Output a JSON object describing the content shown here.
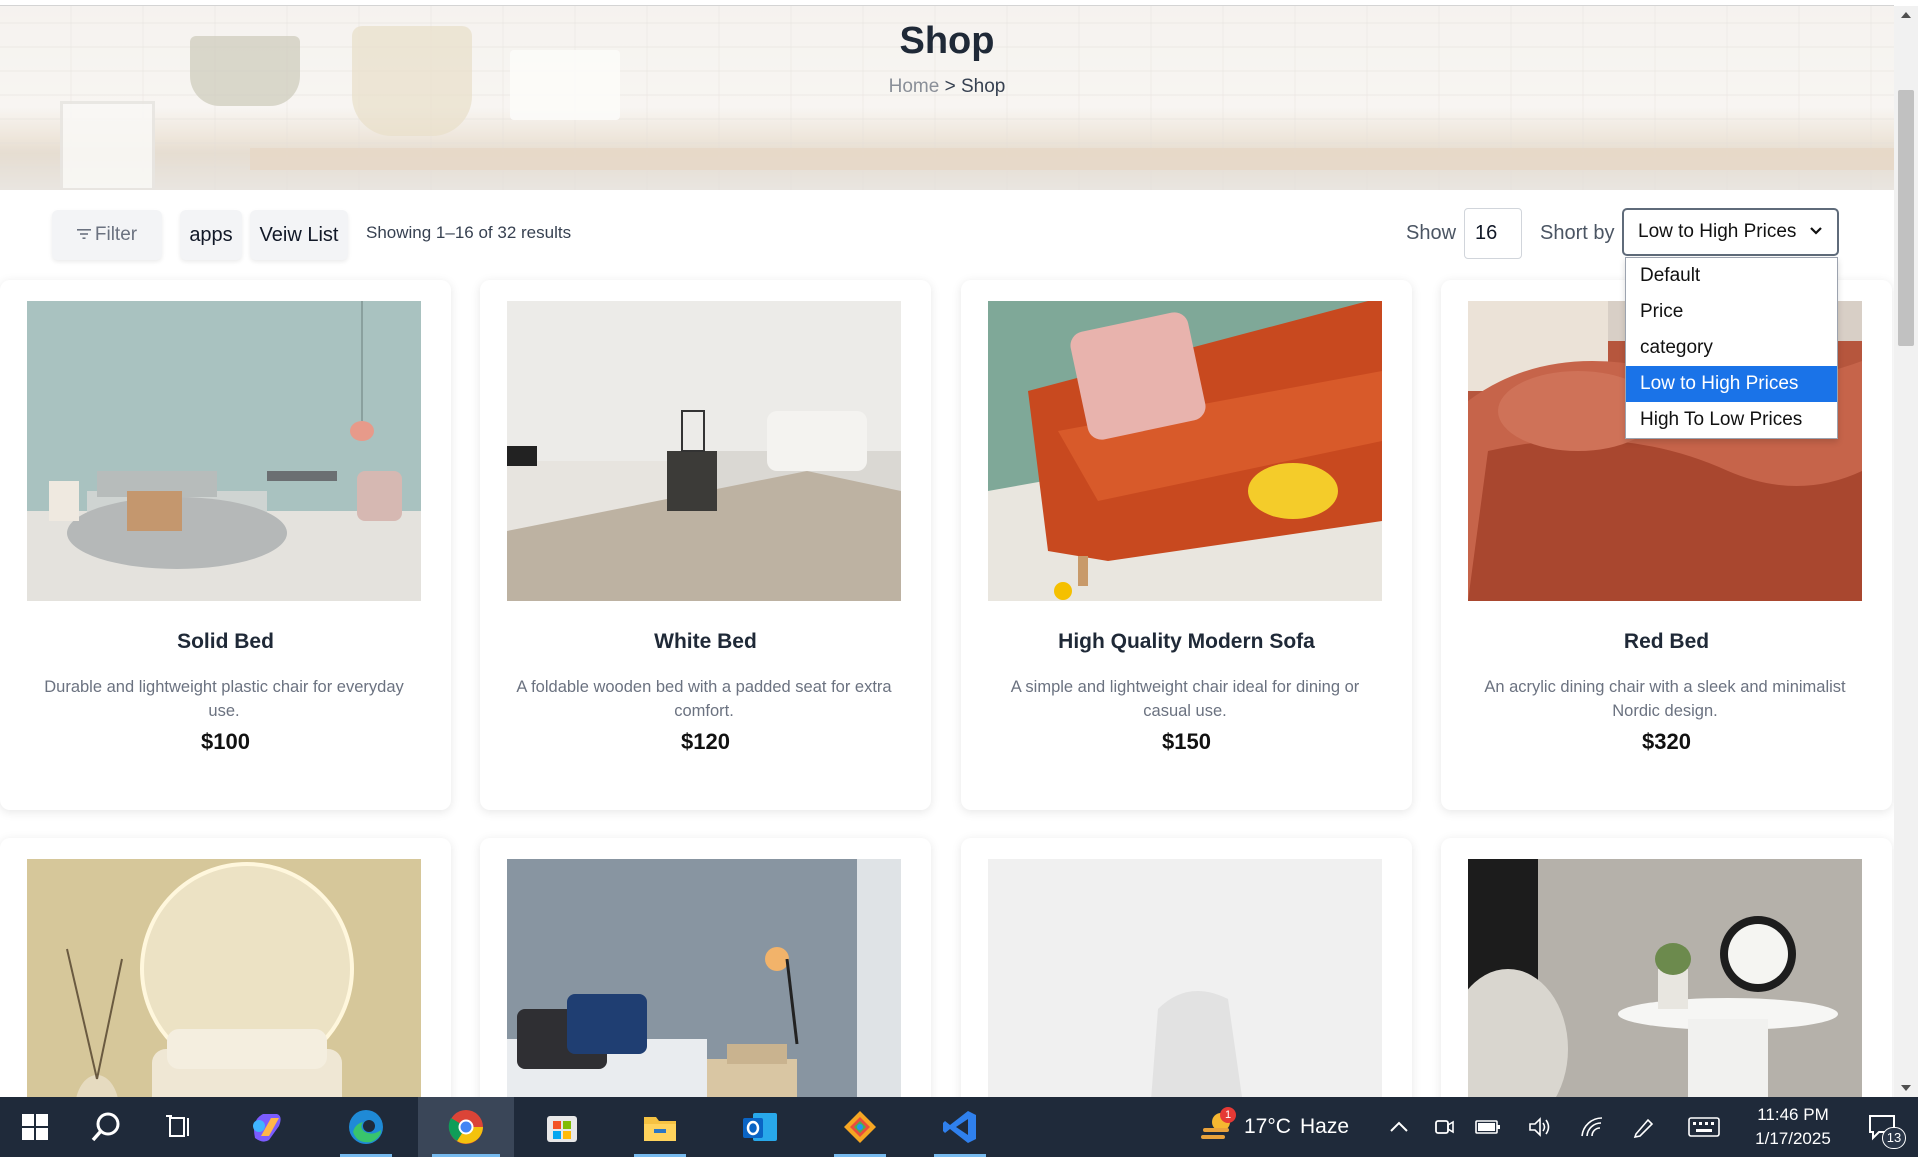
{
  "hero": {
    "title": "Shop",
    "breadcrumb_home": "Home",
    "breadcrumb_sep": ">",
    "breadcrumb_current": "Shop"
  },
  "toolbar": {
    "filter_label": "Filter",
    "apps_label": "apps",
    "list_label": "Veiw List",
    "showing_text": "Showing 1–16 of 32 results",
    "show_label": "Show",
    "show_value": "16",
    "sort_label": "Short by",
    "sort_selected": "Low to High Prices"
  },
  "sort_options": [
    "Default",
    "Price",
    "category",
    "Low to High Prices",
    "High To Low Prices"
  ],
  "sort_selected_index": 3,
  "products": [
    {
      "name": "Solid Bed",
      "description": "Durable and lightweight plastic chair for everyday use.",
      "price": "$100"
    },
    {
      "name": "White Bed",
      "description": "A foldable wooden bed with a padded seat for extra comfort.",
      "price": "$120"
    },
    {
      "name": "High Quality Modern Sofa",
      "description": "A simple and lightweight chair ideal for dining or casual use.",
      "price": "$150"
    },
    {
      "name": "Red Bed",
      "description": "An acrylic dining chair with a sleek and minimalist Nordic design.",
      "price": "$320"
    }
  ],
  "taskbar": {
    "weather_temp": "17°C",
    "weather_desc": "Haze",
    "weather_badge": "1",
    "time": "11:46 PM",
    "date": "1/17/2025",
    "notification_count": "13"
  },
  "colors": {
    "accent_selected": "#1a73e8",
    "taskbar_bg": "#1f2a3a",
    "vscode_blue": "#2f80ed"
  }
}
